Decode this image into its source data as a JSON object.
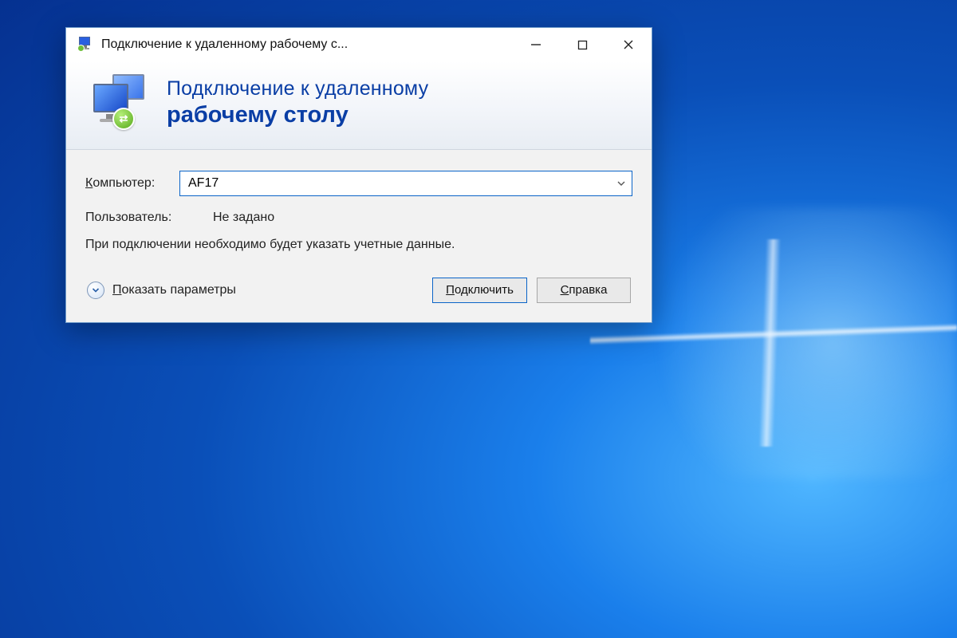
{
  "titlebar": {
    "title": "Подключение к удаленному рабочему с..."
  },
  "header": {
    "line1": "Подключение к удаленному",
    "line2": "рабочему столу"
  },
  "form": {
    "computer_label": "Компьютер:",
    "computer_value": "AF17",
    "user_label": "Пользователь:",
    "user_value": "Не задано",
    "info": "При подключении необходимо будет указать учетные данные."
  },
  "footer": {
    "show_options": "Показать параметры",
    "connect": "Подключить",
    "help": "Справка"
  }
}
